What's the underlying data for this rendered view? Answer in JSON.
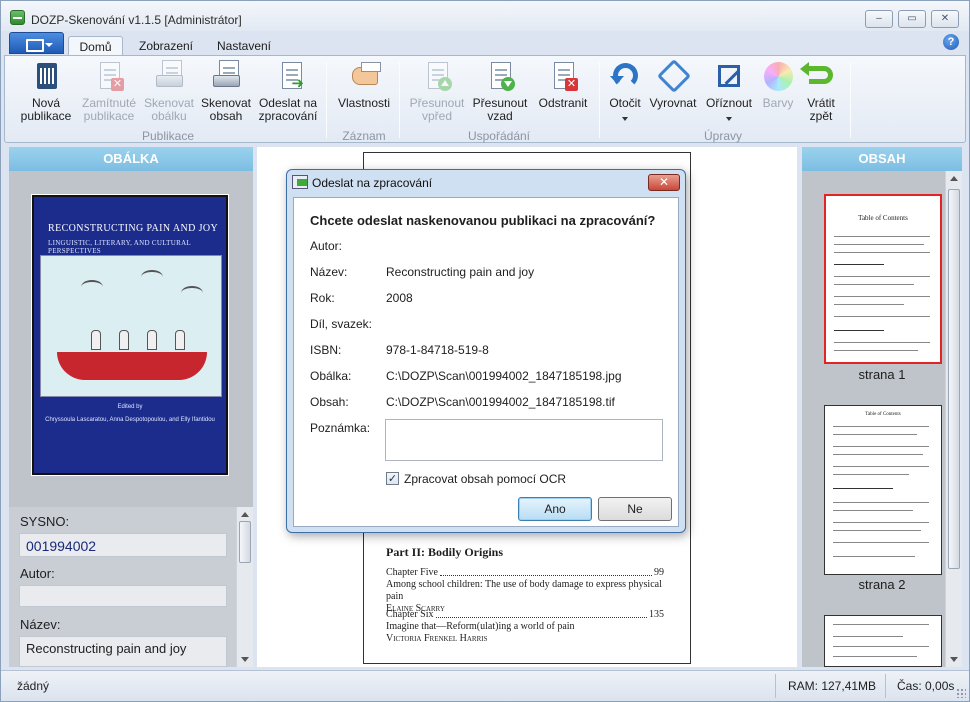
{
  "window": {
    "title": "DOZP-Skenování v1.1.5 [Administrátor]",
    "controls": {
      "minimize": "‒",
      "maximize": "▭",
      "close": "✕"
    }
  },
  "ribbon": {
    "tabs": [
      {
        "label": "Domů",
        "active": true
      },
      {
        "label": "Zobrazení",
        "active": false
      },
      {
        "label": "Nastavení",
        "active": false
      }
    ],
    "help": "?",
    "groups": {
      "publikace": "Publikace",
      "zaznam": "Záznam",
      "usporadani": "Uspořádání",
      "upravy": "Úpravy"
    },
    "buttons": {
      "nova_publikace": "Nová\npublikace",
      "zamitnute_publikace": "Zamítnuté\npublikace",
      "skenovat_obalku": "Skenovat\nobálku",
      "skenovat_obsah": "Skenovat\nobsah",
      "odeslat_na_zpracovani": "Odeslat na\nzpracování",
      "vlastnosti": "Vlastnosti",
      "presunout_vpred": "Přesunout\nvpřed",
      "presunout_vzad": "Přesunout\nvzad",
      "odstranit": "Odstranit",
      "otocit": "Otočit",
      "vyrovnat": "Vyrovnat",
      "oriznout": "Oříznout",
      "barvy": "Barvy",
      "vratit_zpet": "Vrátit\nzpět"
    }
  },
  "left_panel": {
    "header": "OBÁLKA",
    "cover": {
      "title": "RECONSTRUCTING PAIN AND JOY",
      "subtitle": "LINGUISTIC, LITERARY, AND CULTURAL PERSPECTIVES",
      "edited_by": "Edited by",
      "editors": "Chryssoula Lascaratou, Anna Despotopoulou, and Elly Ifantidou"
    },
    "fields": {
      "sysno_label": "SYSNO:",
      "sysno_value": "001994002",
      "autor_label": "Autor:",
      "autor_value": "",
      "nazev_label": "Název:",
      "nazev_value": "Reconstructing pain and joy"
    }
  },
  "center": {
    "section": "Part II: Bodily Origins",
    "entries": [
      {
        "chapter": "Chapter Five",
        "page": "99",
        "title": "Among school children: The use of body damage to express physical pain",
        "author": "Elaine Scarry"
      },
      {
        "chapter": "Chapter Six",
        "page": "135",
        "title": "Imagine that—Reform(ulat)ing a world of pain",
        "author": "Victoria Frenkel Harris"
      }
    ]
  },
  "right_panel": {
    "header": "OBSAH",
    "thumbs": [
      {
        "caption": "strana 1",
        "heading": "Table of Contents",
        "selected": true
      },
      {
        "caption": "strana 2",
        "heading": "Table of Contents",
        "selected": false
      }
    ]
  },
  "dialog": {
    "title": "Odeslat na zpracování",
    "close": "✕",
    "question": "Chcete odeslat naskenovanou publikaci na zpracování?",
    "fields": {
      "autor_label": "Autor:",
      "autor_value": "",
      "nazev_label": "Název:",
      "nazev_value": "Reconstructing pain and joy",
      "rok_label": "Rok:",
      "rok_value": "2008",
      "dil_label": "Díl, svazek:",
      "dil_value": "",
      "isbn_label": "ISBN:",
      "isbn_value": "978-1-84718-519-8",
      "obalka_label": "Obálka:",
      "obalka_value": "C:\\DOZP\\Scan\\001994002_1847185198.jpg",
      "obsah_label": "Obsah:",
      "obsah_value": "C:\\DOZP\\Scan\\001994002_1847185198.tif",
      "poznamka_label": "Poznámka:",
      "poznamka_value": ""
    },
    "ocr_checked": true,
    "ocr_label": "Zpracovat obsah pomocí OCR",
    "yes": "Ano",
    "no": "Ne"
  },
  "status": {
    "left": "žádný",
    "ram": "RAM: 127,41MB",
    "time": "Čas: 0,00s"
  }
}
